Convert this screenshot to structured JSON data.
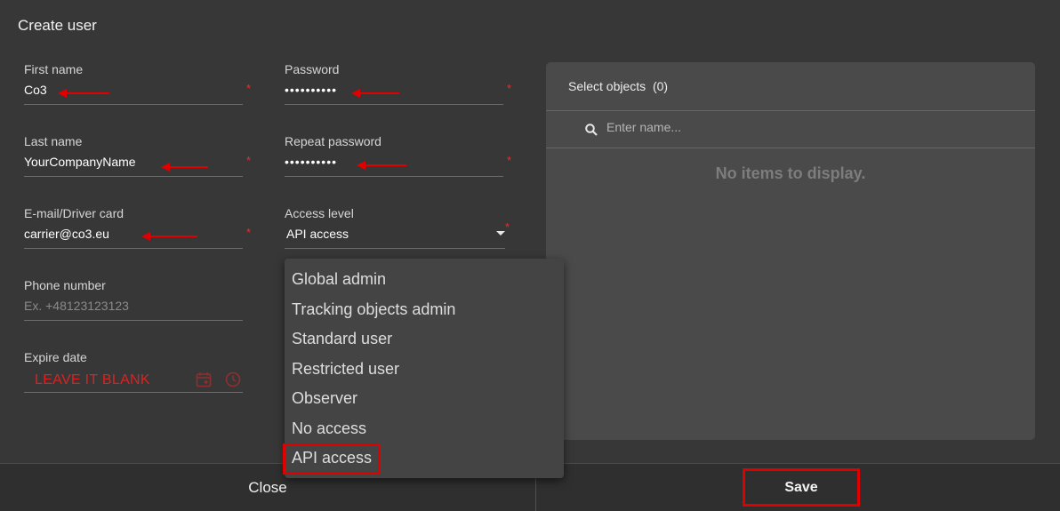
{
  "dialog": {
    "title": "Create user"
  },
  "form": {
    "first_name": {
      "label": "First name",
      "value": "Co3"
    },
    "last_name": {
      "label": "Last name",
      "value": "YourCompanyName"
    },
    "email": {
      "label": "E-mail/Driver card",
      "value": "carrier@co3.eu"
    },
    "phone": {
      "label": "Phone number",
      "placeholder": "Ex. +48123123123"
    },
    "expire": {
      "label": "Expire date",
      "annotation": "LEAVE IT BLANK"
    },
    "password": {
      "label": "Password",
      "value": "••••••••••"
    },
    "repeat_password": {
      "label": "Repeat password",
      "value": "••••••••••"
    },
    "access_level": {
      "label": "Access level",
      "value": "API access"
    },
    "required_mark": "*"
  },
  "access_options": [
    "Global admin",
    "Tracking objects admin",
    "Standard user",
    "Restricted user",
    "Observer",
    "No access",
    "API access"
  ],
  "objects_panel": {
    "title": "Select objects",
    "count": "(0)",
    "search_placeholder": "Enter name...",
    "empty": "No items to display."
  },
  "footer": {
    "close_label": "Close",
    "save_label": "Save"
  },
  "colors": {
    "annotation": "#e00000",
    "background": "#373737",
    "panel": "#4a4a4a"
  }
}
